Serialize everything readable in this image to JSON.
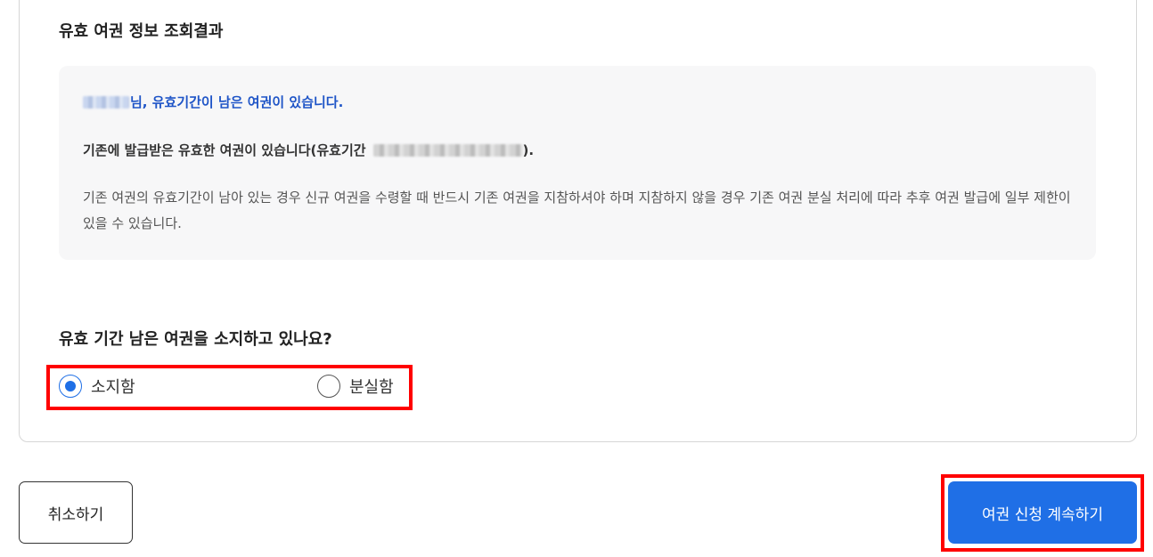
{
  "section_title": "유효 여권 정보 조회결과",
  "info": {
    "headline_suffix": "님, 유효기간이 남은 여권이 있습니다.",
    "line2_prefix": "기존에 발급받은 유효한 여권이 있습니다(유효기간",
    "line2_suffix": ").",
    "description": "기존 여권의 유효기간이 남아 있는 경우 신규 여권을 수령할 때 반드시 기존 여권을 지참하셔야 하며 지참하지 않을 경우 기존 여권 분실 처리에 따라 추후 여권 발급에 일부 제한이 있을 수 있습니다."
  },
  "question": "유효 기간 남은 여권을 소지하고 있나요?",
  "radio_options": [
    {
      "label": "소지함",
      "checked": true
    },
    {
      "label": "분실함",
      "checked": false
    }
  ],
  "buttons": {
    "cancel": "취소하기",
    "continue": "여권 신청 계속하기"
  },
  "colors": {
    "accent": "#1f6fe6",
    "headline": "#1f55c7",
    "highlight": "#ff0000"
  }
}
